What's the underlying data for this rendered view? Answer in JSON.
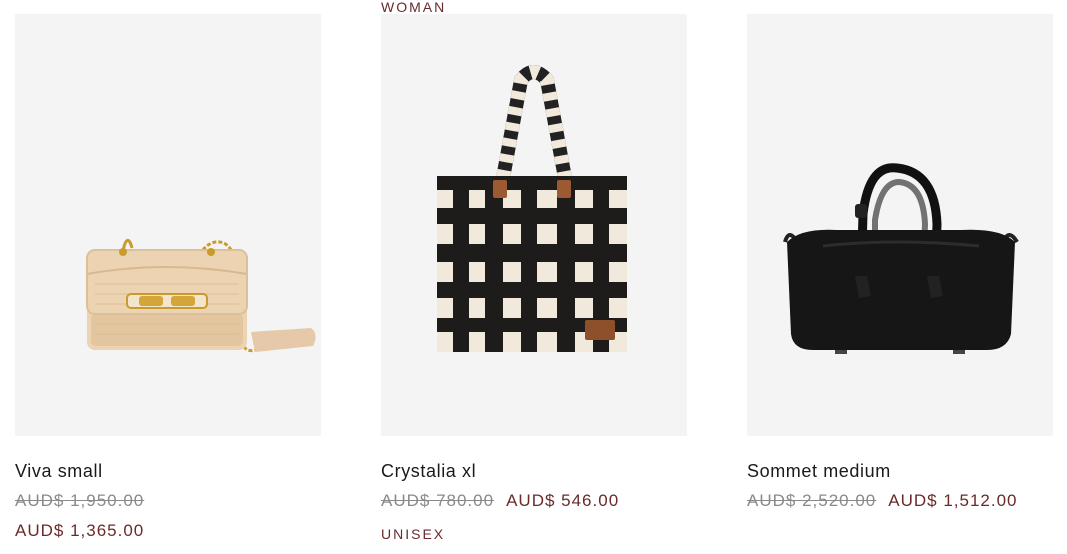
{
  "products": [
    {
      "name": "Viva small",
      "original_price": "AUD$ 1,950.00",
      "sale_price": "AUD$ 1,365.00",
      "image_icon": "beige-woven-shoulder-bag"
    },
    {
      "category_top": "WOMAN",
      "name": "Crystalia xl",
      "original_price": "AUD$ 780.00",
      "sale_price": "AUD$ 546.00",
      "category_bottom": "UNISEX",
      "image_icon": "black-white-check-tote-bag"
    },
    {
      "name": "Sommet medium",
      "original_price": "AUD$ 2,520.00",
      "sale_price": "AUD$ 1,512.00",
      "image_icon": "black-leather-handbag"
    }
  ],
  "colors": {
    "image_background": "#f4f4f4",
    "sale_price": "#6a2a2a",
    "strike_price": "#8a8a8a"
  }
}
